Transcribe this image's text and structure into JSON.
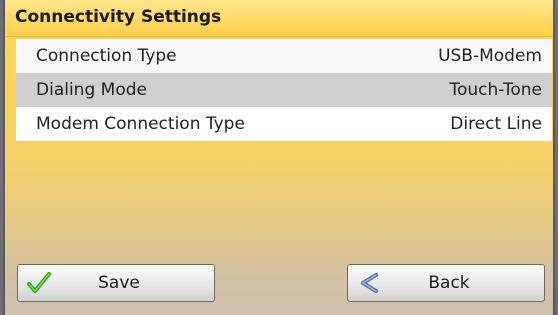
{
  "header": {
    "title": "Connectivity Settings"
  },
  "settings": [
    {
      "label": "Connection Type",
      "value": "USB-Modem"
    },
    {
      "label": "Dialing Mode",
      "value": "Touch-Tone"
    },
    {
      "label": "Modem Connection Type",
      "value": "Direct Line"
    }
  ],
  "buttons": {
    "save_label": "Save",
    "back_label": "Back"
  },
  "icons": {
    "save": "checkmark-icon",
    "back": "back-arrow-icon"
  },
  "colors": {
    "header": "#ffd04a",
    "background_top": "#ffd25a",
    "checkmark": "#2aa11a",
    "back_arrow": "#5b6fa8"
  }
}
